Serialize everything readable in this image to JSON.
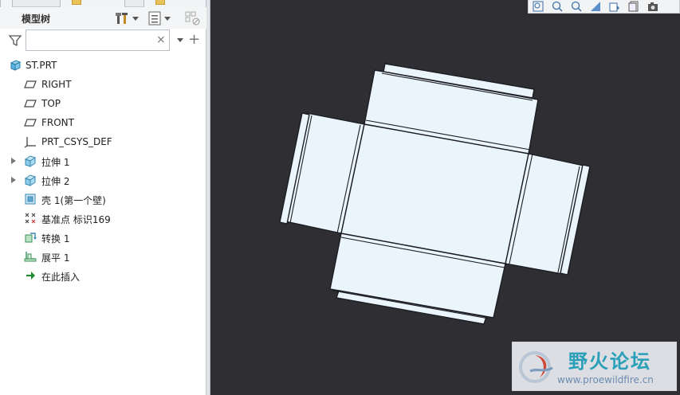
{
  "panel": {
    "title": "模型树",
    "search": {
      "value": "",
      "placeholder": ""
    },
    "clear_glyph": "×",
    "add_glyph": "+"
  },
  "tree": {
    "items": [
      {
        "label": "ST.PRT",
        "icon": "part-icon",
        "expandable": false,
        "root": true
      },
      {
        "label": "RIGHT",
        "icon": "datum-plane-icon",
        "expandable": false
      },
      {
        "label": "TOP",
        "icon": "datum-plane-icon",
        "expandable": false
      },
      {
        "label": "FRONT",
        "icon": "datum-plane-icon",
        "expandable": false
      },
      {
        "label": "PRT_CSYS_DEF",
        "icon": "coordinate-system-icon",
        "expandable": false
      },
      {
        "label": "拉伸 1",
        "icon": "extrude-icon",
        "expandable": true
      },
      {
        "label": "拉伸 2",
        "icon": "extrude-icon",
        "expandable": true
      },
      {
        "label": "壳 1(第一个壁)",
        "icon": "shell-icon",
        "expandable": false
      },
      {
        "label": "基准点 标识169",
        "icon": "datum-point-icon",
        "expandable": false
      },
      {
        "label": "转换 1",
        "icon": "convert-icon",
        "expandable": false
      },
      {
        "label": "展平 1",
        "icon": "flatten-icon",
        "expandable": false
      },
      {
        "label": "在此插入",
        "icon": "insert-here-icon",
        "expandable": false
      }
    ]
  },
  "watermark": {
    "brand": "野火论坛",
    "url": "www.proewildfire.cn"
  },
  "colors": {
    "canvas_bg": "#2f2f33",
    "sheet_fill": "#eaf5fb",
    "edge": "#1b1d22",
    "accent": "#2aa0b8"
  }
}
